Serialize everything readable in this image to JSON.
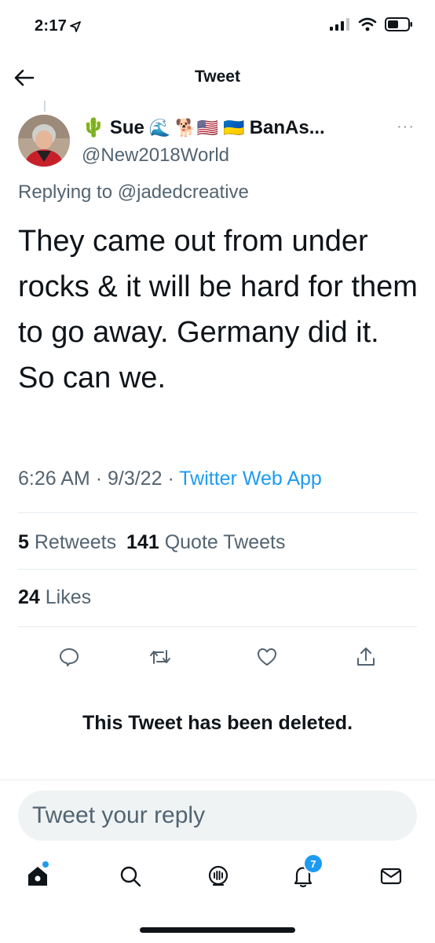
{
  "status_bar": {
    "time": "2:17",
    "icons": [
      "location-arrow-icon",
      "cellular-signal-icon",
      "wifi-icon",
      "battery-icon"
    ]
  },
  "header": {
    "title": "Tweet",
    "back_icon": "back-arrow-icon"
  },
  "tweet": {
    "author": {
      "name_prefix_emoji": "🌵",
      "name": "Sue",
      "name_suffix_emoji": "🌊 🐕🇺🇸 🇺🇦",
      "name_tail": "BanAs...",
      "handle": "@New2018World"
    },
    "more_label": "···",
    "replying_label": "Replying to",
    "replying_to": "@jadedcreative",
    "text": "They came out from under rocks & it will be hard for them to go away.  Germany did it.  So can we.",
    "time": "6:26 AM",
    "date": "9/3/22",
    "via": "Twitter Web App",
    "stats": {
      "retweets_count": "5",
      "retweets_label": "Retweets",
      "quotes_count": "141",
      "quotes_label": "Quote Tweets",
      "likes_count": "24",
      "likes_label": "Likes"
    },
    "actions": [
      "reply-icon",
      "retweet-icon",
      "like-icon",
      "share-icon"
    ]
  },
  "deleted_notice": "This Tweet has been deleted.",
  "reply": {
    "placeholder": "Tweet your reply"
  },
  "tabbar": {
    "items": [
      "home-icon",
      "search-icon",
      "spaces-icon",
      "notifications-icon",
      "messages-icon"
    ],
    "notifications_badge": "7"
  },
  "colors": {
    "accent": "#1d9bf0",
    "text": "#0f1419",
    "secondary": "#536471",
    "divider": "#e6ecf0"
  }
}
